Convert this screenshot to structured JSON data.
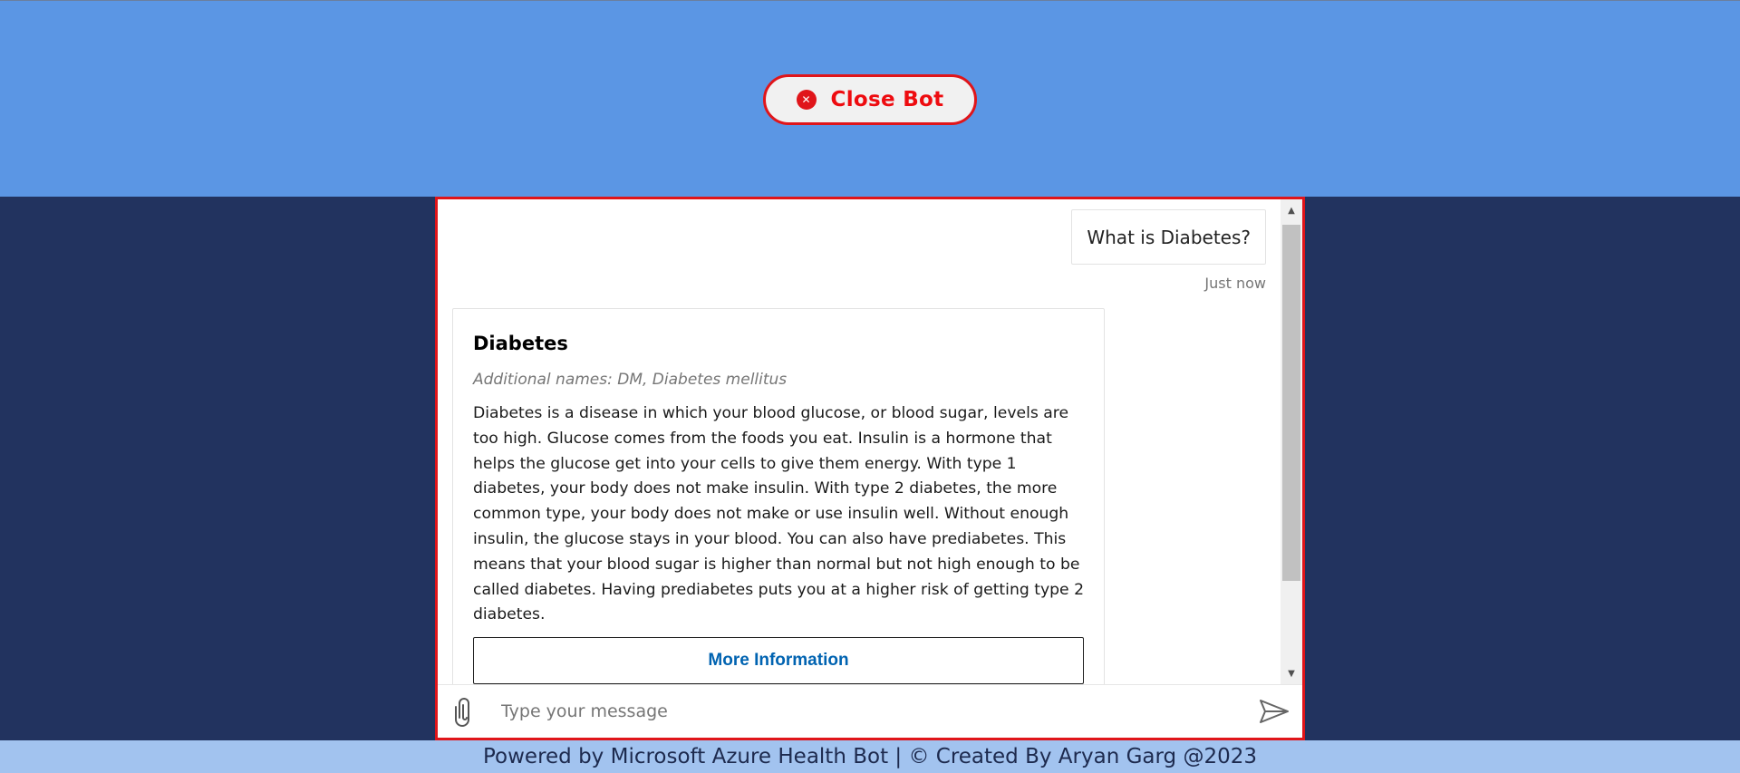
{
  "header": {
    "close_bot_label": "Close Bot",
    "close_icon": "close-circle-icon"
  },
  "transcript": {
    "user_message": "What is Diabetes?",
    "user_timestamp": "Just now",
    "card": {
      "title": "Diabetes",
      "subtitle": "Additional names: DM, Diabetes mellitus",
      "body": "Diabetes is a disease in which your blood glucose, or blood sugar, levels are too high. Glucose comes from the foods you eat. Insulin is a hormone that helps the glucose get into your cells to give them energy. With type 1 diabetes, your body does not make insulin. With type 2 diabetes, the more common type, your body does not make or use insulin well. Without enough insulin, the glucose stays in your blood. You can also have prediabetes. This means that your blood sugar is higher than normal but not high enough to be called diabetes. Having prediabetes puts you at a higher risk of getting type 2 diabetes.",
      "action_label": "More Information"
    }
  },
  "send_box": {
    "placeholder": "Type your message",
    "attach_icon": "paperclip-icon",
    "send_icon": "send-icon"
  },
  "footer": {
    "text": "Powered by Microsoft Azure Health Bot | © Created By Aryan Garg @2023"
  },
  "colors": {
    "top_band": "#5b96e4",
    "page_background": "#22335f",
    "accent_red": "#e0151a",
    "link_blue": "#0063b1",
    "footer_background": "#a2c3ef"
  }
}
